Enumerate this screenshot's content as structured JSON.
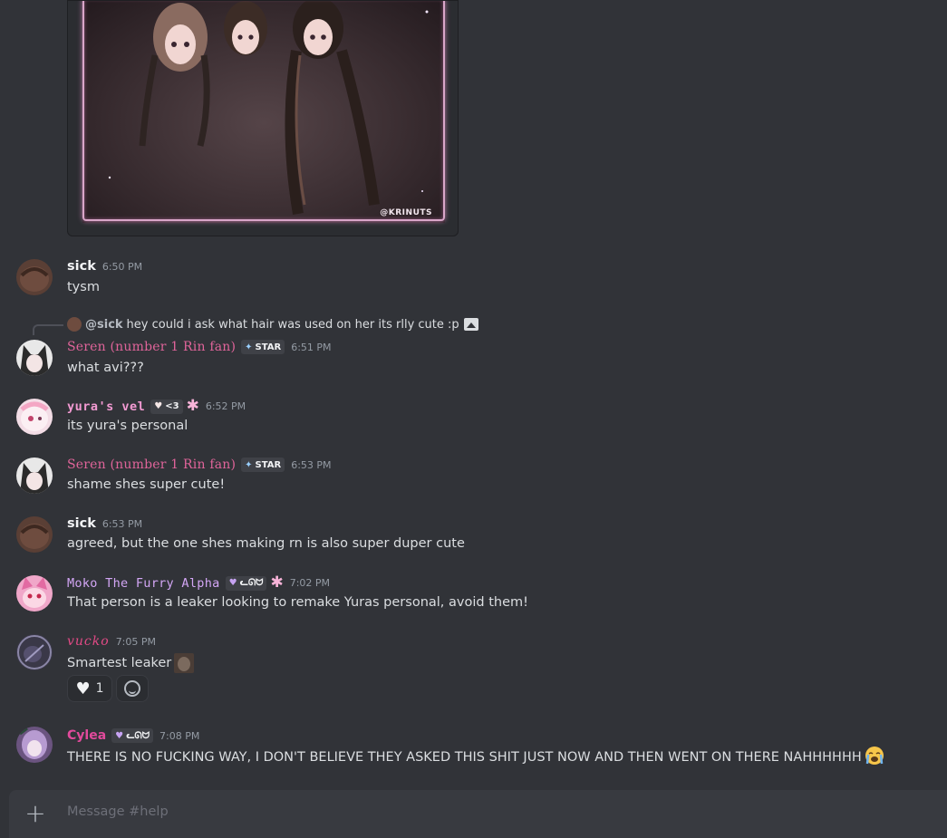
{
  "attachment": {
    "watermark": "@KRINUTS"
  },
  "messages": [
    {
      "id": "m1",
      "username": "sick",
      "timestamp": "6:50 PM",
      "text": "tysm"
    },
    {
      "id": "m2",
      "reply": {
        "user": "@sick",
        "text": "hey could i ask what hair was used on her its rlly cute :p"
      },
      "username": "Seren (number 1 Rin fan)",
      "tag": "STAR",
      "timestamp": "6:51 PM",
      "text": "what avi???"
    },
    {
      "id": "m3",
      "username": "yura's vel",
      "tag": "<3",
      "timestamp": "6:52 PM",
      "text": "its yura's personal"
    },
    {
      "id": "m4",
      "username": "Seren (number 1 Rin fan)",
      "tag": "STAR",
      "timestamp": "6:53 PM",
      "text": "shame shes super cute!"
    },
    {
      "id": "m5",
      "username": "sick",
      "timestamp": "6:53 PM",
      "text": "agreed, but the one shes making rn is also super duper cute"
    },
    {
      "id": "m6",
      "username": "Moko The Furry Alpha",
      "tag": "ᓚᘏᗢ",
      "timestamp": "7:02 PM",
      "text": "That person is a leaker looking to remake Yuras personal, avoid them!"
    },
    {
      "id": "m7",
      "username": "vucko",
      "timestamp": "7:05 PM",
      "text": "Smartest leaker",
      "reactions": [
        {
          "emoji": "heart",
          "count": "1"
        }
      ]
    },
    {
      "id": "m8",
      "username": "Cylea",
      "tag": "ᓚᘏᗢ",
      "timestamp": "7:08 PM",
      "text": "THERE IS NO FUCKING WAY, I DON'T BELIEVE THEY ASKED THIS SHIT JUST NOW AND THEN WENT ON THERE NAHHHHHH"
    }
  ],
  "composer": {
    "placeholder": "Message #help",
    "add_icon": "+"
  },
  "colors": {
    "background": "#313338",
    "composer": "#383a40",
    "seren": "#e0649a",
    "yura": "#f29ad2",
    "moko": "#d3a6f5",
    "vucko": "#e24a86",
    "cylea": "#e24a9c"
  }
}
